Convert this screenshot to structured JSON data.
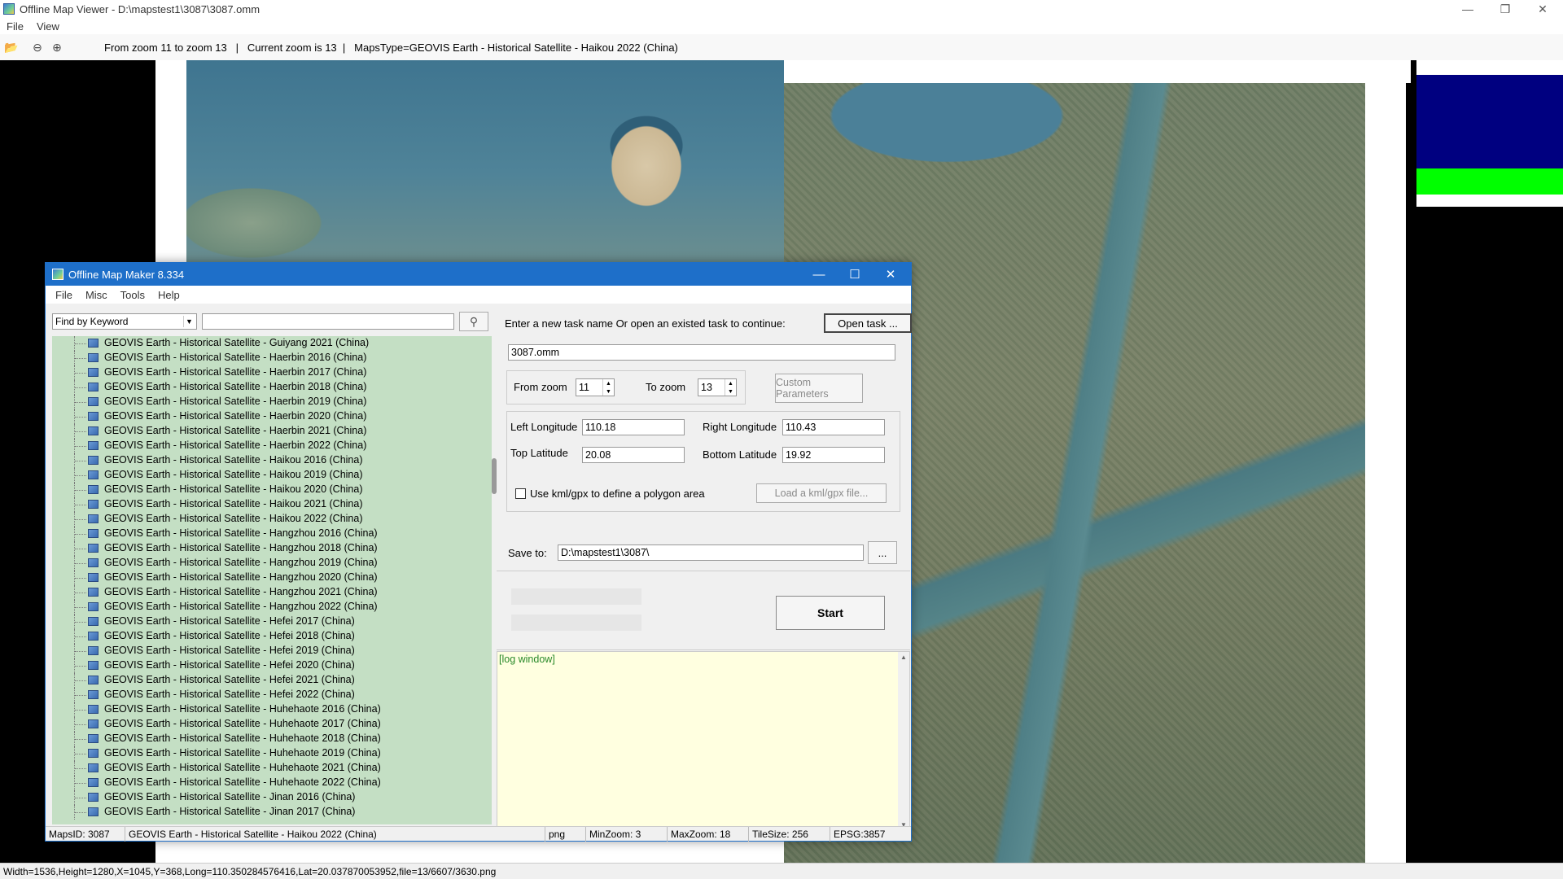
{
  "viewer": {
    "title": "Offline Map Viewer - D:\\mapstest1\\3087\\3087.omm",
    "menu": [
      "File",
      "View"
    ],
    "toolbar": {
      "zoom_range": "From zoom 11 to zoom 13",
      "sep": "|",
      "current_zoom": "Current zoom is 13",
      "maps_type": "MapsType=GEOVIS Earth - Historical Satellite - Haikou 2022 (China)"
    },
    "statusbar": "Width=1536,Height=1280,X=1045,Y=368,Long=110.350284576416,Lat=20.037870053952,file=13/6607/3630.png",
    "legend_colors": {
      "blue": "#000080",
      "green": "#00ff00"
    }
  },
  "maker": {
    "title": "Offline Map Maker 8.334",
    "menu": [
      "File",
      "Misc",
      "Tools",
      "Help"
    ],
    "find": {
      "selected": "Find by Keyword",
      "search_value": ""
    },
    "tree_items": [
      "GEOVIS Earth - Historical Satellite - Guiyang 2021 (China)",
      "GEOVIS Earth - Historical Satellite - Haerbin 2016 (China)",
      "GEOVIS Earth - Historical Satellite - Haerbin 2017 (China)",
      "GEOVIS Earth - Historical Satellite - Haerbin 2018 (China)",
      "GEOVIS Earth - Historical Satellite - Haerbin 2019 (China)",
      "GEOVIS Earth - Historical Satellite - Haerbin 2020 (China)",
      "GEOVIS Earth - Historical Satellite - Haerbin 2021 (China)",
      "GEOVIS Earth - Historical Satellite - Haerbin 2022 (China)",
      "GEOVIS Earth - Historical Satellite - Haikou 2016 (China)",
      "GEOVIS Earth - Historical Satellite - Haikou 2019 (China)",
      "GEOVIS Earth - Historical Satellite - Haikou 2020 (China)",
      "GEOVIS Earth - Historical Satellite - Haikou 2021 (China)",
      "GEOVIS Earth - Historical Satellite - Haikou 2022 (China)",
      "GEOVIS Earth - Historical Satellite - Hangzhou 2016 (China)",
      "GEOVIS Earth - Historical Satellite - Hangzhou 2018 (China)",
      "GEOVIS Earth - Historical Satellite - Hangzhou 2019 (China)",
      "GEOVIS Earth - Historical Satellite - Hangzhou 2020 (China)",
      "GEOVIS Earth - Historical Satellite - Hangzhou 2021 (China)",
      "GEOVIS Earth - Historical Satellite - Hangzhou 2022 (China)",
      "GEOVIS Earth - Historical Satellite - Hefei 2017 (China)",
      "GEOVIS Earth - Historical Satellite - Hefei 2018 (China)",
      "GEOVIS Earth - Historical Satellite - Hefei 2019 (China)",
      "GEOVIS Earth - Historical Satellite - Hefei 2020 (China)",
      "GEOVIS Earth - Historical Satellite - Hefei 2021 (China)",
      "GEOVIS Earth - Historical Satellite - Hefei 2022 (China)",
      "GEOVIS Earth - Historical Satellite - Huhehaote 2016 (China)",
      "GEOVIS Earth - Historical Satellite - Huhehaote 2017 (China)",
      "GEOVIS Earth - Historical Satellite - Huhehaote 2018 (China)",
      "GEOVIS Earth - Historical Satellite - Huhehaote 2019 (China)",
      "GEOVIS Earth - Historical Satellite - Huhehaote 2021 (China)",
      "GEOVIS Earth - Historical Satellite - Huhehaote 2022 (China)",
      "GEOVIS Earth - Historical Satellite - Jinan 2016 (China)",
      "GEOVIS Earth - Historical Satellite - Jinan 2017 (China)"
    ],
    "task_prompt": "Enter a new task name Or open an existed task to continue:",
    "open_task_label": "Open task ...",
    "task_name": "3087.omm",
    "from_zoom_label": "From zoom",
    "from_zoom": "11",
    "to_zoom_label": "To zoom",
    "to_zoom": "13",
    "custom_params_label": "Custom Parameters",
    "left_lon_label": "Left Longitude",
    "left_lon": "110.18",
    "right_lon_label": "Right Longitude",
    "right_lon": "110.43",
    "top_lat_label": "Top Latitude",
    "top_lat": "20.08",
    "bottom_lat_label": "Bottom Latitude",
    "bottom_lat": "19.92",
    "kml_label": "Use kml/gpx to define a polygon area",
    "load_kml_label": "Load a kml/gpx file...",
    "save_to_label": "Save to:",
    "save_to": "D:\\mapstest1\\3087\\",
    "browse_label": "...",
    "start_label": "Start",
    "log_title": "[log window]",
    "status": {
      "maps_id": "MapsID: 3087",
      "maps_name": "GEOVIS Earth - Historical Satellite - Haikou 2022 (China)",
      "format": "png",
      "min_zoom": "MinZoom: 3",
      "max_zoom": "MaxZoom: 18",
      "tile_size": "TileSize: 256",
      "epsg": "EPSG:3857"
    }
  }
}
